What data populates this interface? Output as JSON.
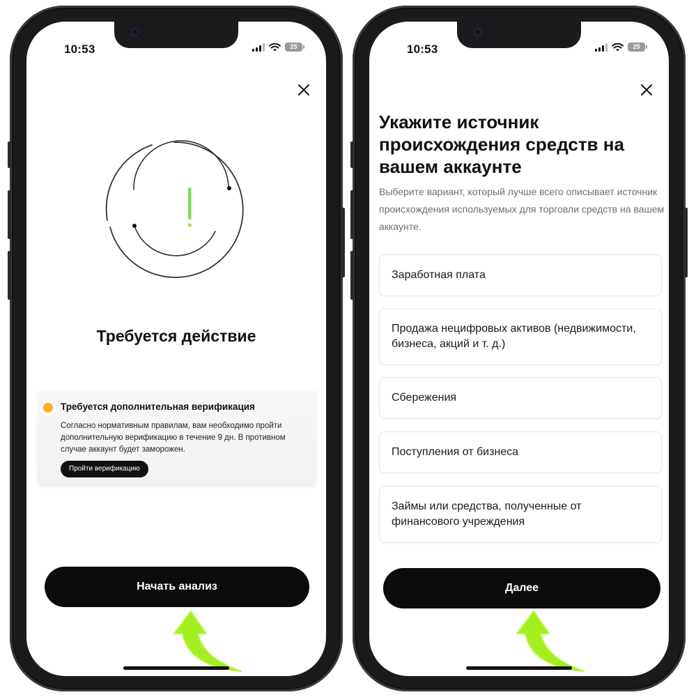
{
  "status": {
    "time": "10:53",
    "battery": "25"
  },
  "left_screen": {
    "title": "Требуется действие",
    "notice": {
      "title": "Требуется дополнительная верификация",
      "text": "Согласно нормативным правилам, вам необходимо пройти дополнительную верификацию в течение 9 дн. В противном случае аккаунт будет заморожен.",
      "button": "Пройти верификацию"
    },
    "primary_button": "Начать анализ"
  },
  "right_screen": {
    "title": "Укажите источник происхождения средств на вашем аккаунте",
    "subtitle": "Выберите вариант, который лучше всего описывает источник происхождения используемых для торговли средств на вашем аккаунте.",
    "options": [
      "Заработная плата",
      "Продажа нецифровых активов (недвижимости, бизнеса, акций и т. д.)",
      "Сбережения",
      "Поступления от бизнеса",
      "Займы или средства, полученные от финансового учреждения"
    ],
    "primary_button": "Далее"
  },
  "colors": {
    "accent_green": "#9be31a",
    "warning_dot": "#f5b324",
    "button_bg": "#0b0b0b"
  },
  "icons": [
    "close-icon",
    "signal-icon",
    "wifi-icon",
    "battery-icon",
    "exclamation-icon",
    "pointer-arrow"
  ]
}
